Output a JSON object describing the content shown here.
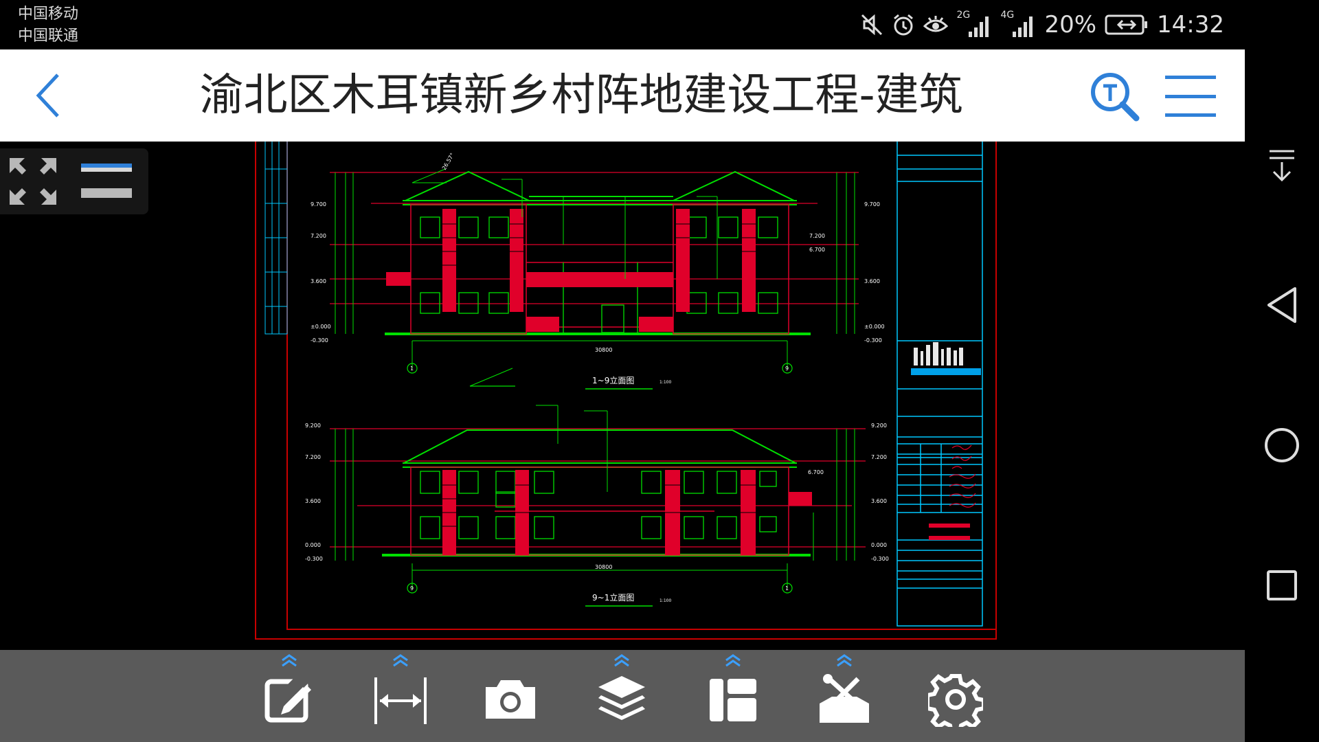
{
  "status_bar": {
    "carrier_1": "中国移动",
    "carrier_2": "中国联通",
    "network_1": "2G",
    "network_2": "4G",
    "battery": "20%",
    "time": "14:32",
    "icons": [
      "mute-icon",
      "alarm-icon",
      "eye-comfort-icon",
      "signal-icon",
      "battery-charging-icon"
    ]
  },
  "header": {
    "title": "渝北区木耳镇新乡村阵地建设工程-建筑",
    "back_icon": "chevron-left-icon",
    "search_icon": "text-search-icon",
    "menu_icon": "hamburger-menu-icon",
    "accent_color": "#2f80d8"
  },
  "drawing": {
    "elevation_1_title": "1~9立面图",
    "elevation_2_title": "9~1立面图",
    "scale": "1:100",
    "total_width_dim": "30800",
    "axis_start": "1",
    "axis_end": "9",
    "axis_start_2": "9",
    "axis_end_2": "1",
    "levels_top": [
      "9.700",
      "7.200",
      "6.700",
      "3.600",
      "±0.000",
      "-0.300"
    ],
    "levels_bottom": [
      "9.200",
      "7.200",
      "6.700",
      "3.600",
      "0.000",
      "-0.300"
    ],
    "slope_note": "26.57°",
    "colors": {
      "green": "#00e000",
      "red": "#e0002a",
      "cyan": "#00c8ff",
      "white": "#ffffff",
      "frame": "#c80000"
    }
  },
  "view_toggle": {
    "fit_icon": "fit-screen-icon",
    "bars_icon": "layout-bars-icon"
  },
  "navigation_bar": {
    "buttons": [
      "notification-down-icon",
      "back-triangle-icon",
      "home-circle-icon",
      "recents-square-icon"
    ]
  },
  "toolbar": {
    "tools": [
      {
        "name": "annotate-icon",
        "expandable": true
      },
      {
        "name": "measure-icon",
        "expandable": true
      },
      {
        "name": "camera-icon",
        "expandable": false
      },
      {
        "name": "layers-icon",
        "expandable": true
      },
      {
        "name": "layout-icon",
        "expandable": true
      },
      {
        "name": "toolbox-icon",
        "expandable": true
      },
      {
        "name": "settings-icon",
        "expandable": false
      }
    ],
    "chevron_color": "#3ba0ff"
  }
}
